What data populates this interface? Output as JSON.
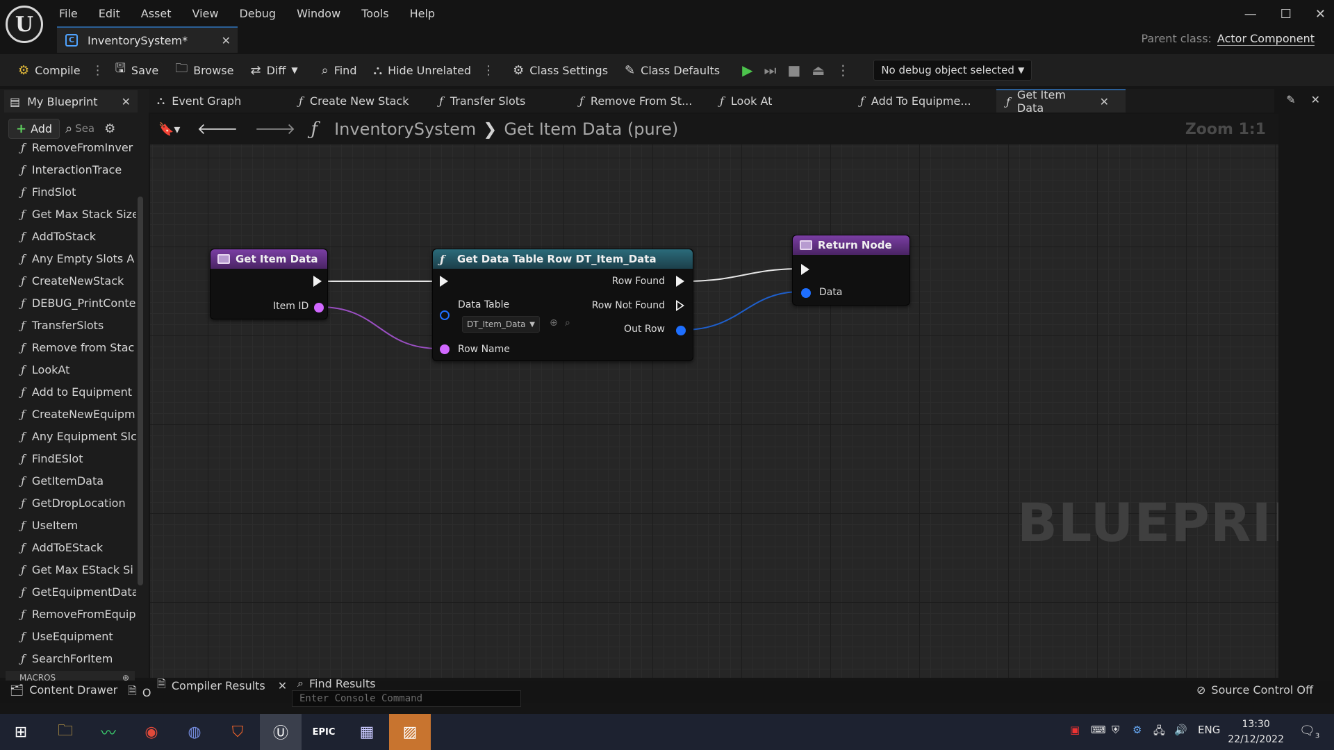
{
  "app": {
    "logo_letter": "U",
    "document_tab": "InventorySystem*",
    "parent_class_label": "Parent class:",
    "parent_class_value": "Actor Component"
  },
  "menu": [
    "File",
    "Edit",
    "Asset",
    "View",
    "Debug",
    "Window",
    "Tools",
    "Help"
  ],
  "toolbar": {
    "compile": "Compile",
    "save": "Save",
    "browse": "Browse",
    "diff": "Diff",
    "find": "Find",
    "hide_unrelated": "Hide Unrelated",
    "class_settings": "Class Settings",
    "class_defaults": "Class Defaults",
    "debug_object": "No debug object selected"
  },
  "my_blueprint": {
    "tab": "My Blueprint",
    "add": "Add",
    "search_placeholder": "Sea",
    "functions": [
      "RemoveFromInver",
      "InteractionTrace",
      "FindSlot",
      "Get Max Stack Size",
      "AddToStack",
      "Any Empty Slots A",
      "CreateNewStack",
      "DEBUG_PrintConte",
      "TransferSlots",
      "Remove from Stac",
      "LookAt",
      "Add to Equipment",
      "CreateNewEquipm",
      "Any Equipment Slc",
      "FindESlot",
      "GetItemData",
      "GetDropLocation",
      "UseItem",
      "AddToEStack",
      "Get Max EStack Si",
      "GetEquipmentData",
      "RemoveFromEquip",
      "UseEquipment",
      "SearchForItem"
    ],
    "macros_header": "MACROS"
  },
  "graph_tabs": [
    "Event Graph",
    "Create New Stack",
    "Transfer Slots",
    "Remove From St...",
    "Look At",
    "Add To Equipme...",
    "Get Item Data"
  ],
  "graph": {
    "breadcrumb_root": "InventorySystem",
    "breadcrumb_current": "Get Item Data (pure)",
    "zoom": "Zoom 1:1",
    "watermark": "BLUEPRINT",
    "nodes": {
      "entry": {
        "title": "Get Item Data",
        "pin_item_id": "Item ID"
      },
      "get_row": {
        "title": "Get Data Table Row DT_Item_Data",
        "pin_data_table": "Data Table",
        "data_table_value": "DT_Item_Data",
        "pin_row_name": "Row Name",
        "pin_row_found": "Row Found",
        "pin_row_not_found": "Row Not Found",
        "pin_out_row": "Out Row"
      },
      "return": {
        "title": "Return Node",
        "pin_data": "Data"
      }
    }
  },
  "bottom": {
    "content_drawer": "Content Drawer",
    "output_log": "O",
    "compiler_results": "Compiler Results",
    "find_results": "Find Results",
    "console_placeholder": "Enter Console Command",
    "source_control": "Source Control Off"
  },
  "taskbar": {
    "lang": "ENG",
    "time": "13:30",
    "date": "22/12/2022",
    "notifications": "3"
  },
  "colors": {
    "accent": "#2b5f97",
    "pin_name": "#d168ff",
    "pin_struct": "#1e6fff",
    "exec": "#f2f2f2"
  }
}
